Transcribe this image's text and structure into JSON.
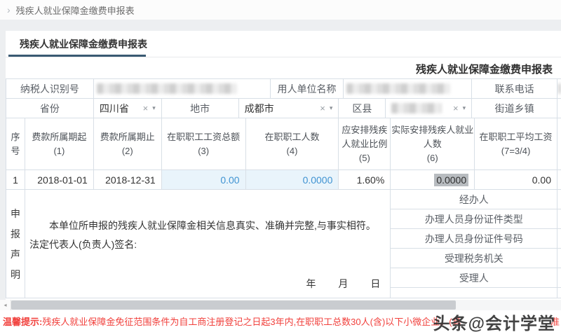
{
  "breadcrumb": {
    "label": "残疾人就业保障金缴费申报表"
  },
  "tab": {
    "label": "残疾人就业保障金缴费申报表"
  },
  "icons": {
    "chevron": "›",
    "clear": "×",
    "dropdown": "▾",
    "scroll_left": "◂"
  },
  "form": {
    "title": "残疾人就业保障金缴费申报表",
    "info": {
      "taxpayer_id_label": "纳税人识别号",
      "employer_name_label": "用人单位名称",
      "phone_label": "联系电话"
    },
    "region": {
      "province_label": "省份",
      "province_value": "四川省",
      "city_label": "地市",
      "city_value": "成都市",
      "district_label": "区县",
      "street_label": "街道乡镇"
    },
    "table": {
      "headers": [
        {
          "l1": "序",
          "l2": "号"
        },
        {
          "l1": "费款所属期起",
          "l2": "(1)"
        },
        {
          "l1": "费款所属期止",
          "l2": "(2)"
        },
        {
          "l1": "在职职工工资总额",
          "l2": "(3)"
        },
        {
          "l1": "在职职工人数",
          "l2": "(4)"
        },
        {
          "l1": "应安排残疾",
          "l2": "人就业比例",
          "l3": "(5)"
        },
        {
          "l1": "实际安排残疾人就业",
          "l2": "人数",
          "l3": "(6)"
        },
        {
          "l1": "在职职工平均工资",
          "l2": "(7=3/4)"
        }
      ],
      "row": {
        "seq": "1",
        "period_start": "2018-01-01",
        "period_end": "2018-12-31",
        "salary_total": "0.00",
        "employee_count": "0.0000",
        "required_ratio": "1.60%",
        "actual_disabled_count": "0.0000",
        "avg_salary": "0.00"
      }
    },
    "declaration": {
      "label_chars": [
        "申",
        "报",
        "声",
        "明"
      ],
      "statement": "本单位所申报的残疾人就业保障金相关信息真实、准确并完整,与事实相符。",
      "signature_line": "法定代表人(负责人)签名:",
      "date_year": "年",
      "date_month": "月",
      "date_day": "日"
    },
    "handlers": {
      "rows": [
        "经办人",
        "办理人员身份证件类型",
        "办理人员身份证件号码",
        "受理税务机关",
        "受理人"
      ]
    }
  },
  "tip": {
    "label": "温馨提示:",
    "text": "残疾人就业保障金免征范围条件为自工商注册登记之日起3年内,在职职工总数30人(含)以下小微企业。(具",
    "tail": "准"
  },
  "watermark": "头条@会计学堂",
  "colors": {
    "accent_blue": "#3f93d2",
    "cell_highlight": "#e9f4fb",
    "tab_underline": "#3a5a72",
    "tip_red": "#f1403c",
    "selected_gray": "#b8bcc0"
  }
}
